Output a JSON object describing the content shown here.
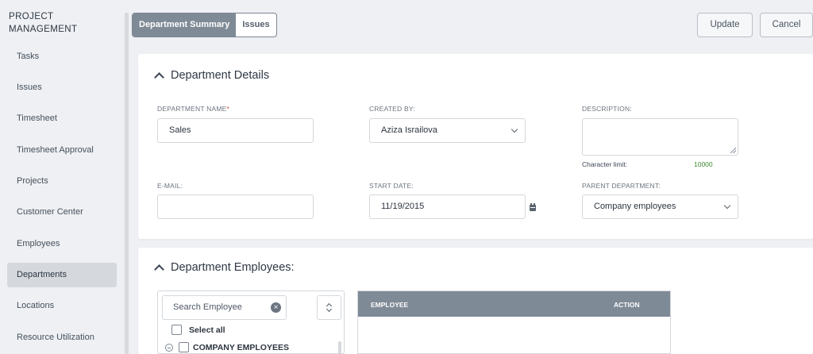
{
  "sidebar": {
    "title_line1": "PROJECT",
    "title_line2": "MANAGEMENT",
    "items": [
      {
        "label": "Tasks"
      },
      {
        "label": "Issues"
      },
      {
        "label": "Timesheet"
      },
      {
        "label": "Timesheet Approval"
      },
      {
        "label": "Projects"
      },
      {
        "label": "Customer Center"
      },
      {
        "label": "Employees"
      },
      {
        "label": "Departments",
        "active": true
      },
      {
        "label": "Locations"
      },
      {
        "label": "Resource Utilization"
      }
    ]
  },
  "tabs": [
    {
      "label": "Department Summary",
      "active": true
    },
    {
      "label": "Issues"
    }
  ],
  "toolbar": {
    "update_label": "Update",
    "cancel_label": "Cancel"
  },
  "details": {
    "heading": "Department Details",
    "department_name": {
      "label": "DEPARTMENT NAME",
      "required_mark": "*",
      "value": "Sales"
    },
    "created_by": {
      "label": "CREATED BY:",
      "value": "Aziza Israilova"
    },
    "description": {
      "label": "DESCRIPTION:",
      "value": "",
      "char_limit_label": "Character limit:",
      "char_limit_value": "10000"
    },
    "email": {
      "label": "E-MAIL:",
      "value": ""
    },
    "start_date": {
      "label": "START DATE:",
      "value": "11/19/2015"
    },
    "parent_department": {
      "label": "PARENT DEPARTMENT:",
      "value": "Company employees"
    }
  },
  "employees": {
    "heading": "Department Employees:",
    "search_placeholder": "Search Employee",
    "select_all": "Select all",
    "group": "COMPANY EMPLOYEES",
    "columns": {
      "employee": "EMPLOYEE",
      "action": "ACTION"
    }
  },
  "colors": {
    "accent": "#7f8a97",
    "green": "#3c8a2e",
    "required": "#d0483b"
  }
}
